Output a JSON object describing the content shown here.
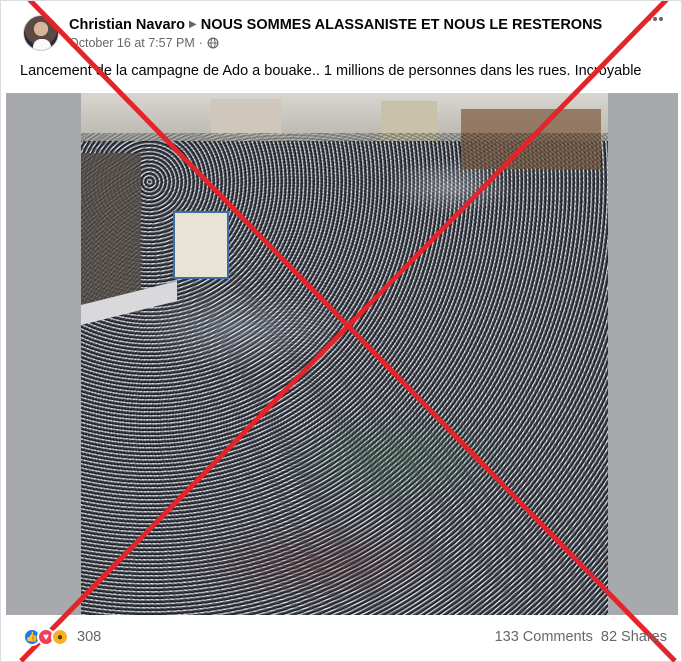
{
  "post": {
    "author": "Christian Navaro",
    "group": "NOUS SOMMES ALASSANISTE ET NOUS LE RESTERONS",
    "timestamp": "October 16 at 7:57 PM",
    "separator": "·",
    "privacy_icon": "globe-icon",
    "text": "Lancement de la campagne de Ado a bouake.. 1 millions de personnes dans les rues. Incroyable"
  },
  "footer": {
    "reactions": [
      "like-icon",
      "love-icon",
      "wow-icon"
    ],
    "reaction_count": "308",
    "comments": "133 Comments",
    "shares": "82 Shares"
  },
  "overlay": {
    "mark": "red-cross-icon",
    "color": "#e4242b"
  },
  "colors": {
    "accent": "#1877f2",
    "muted_text": "#65676b"
  }
}
